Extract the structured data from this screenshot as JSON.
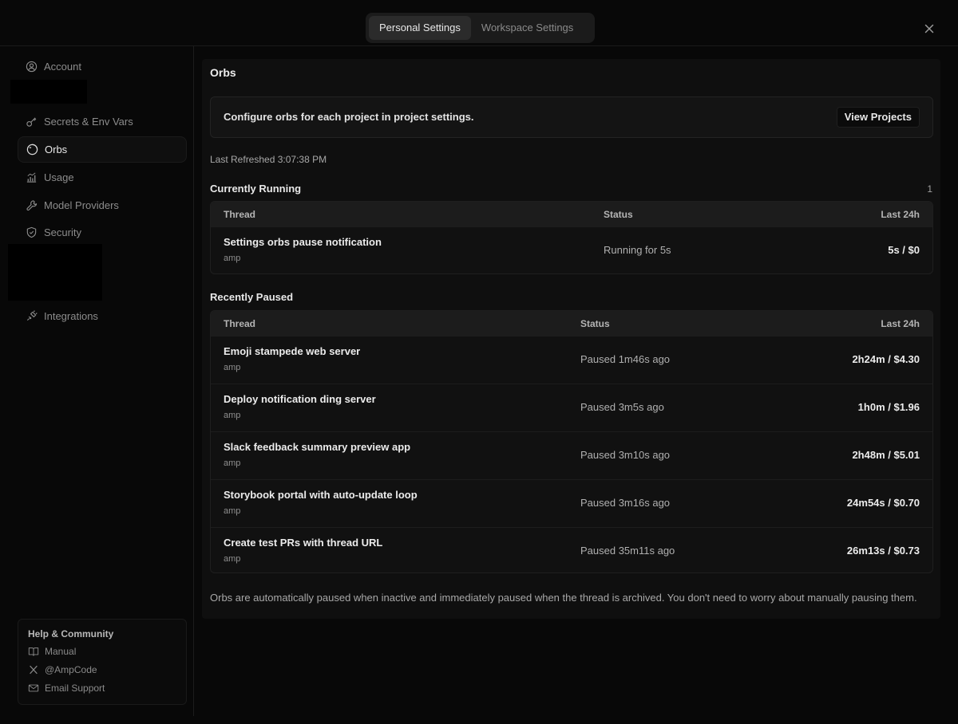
{
  "tabs": {
    "personal": "Personal Settings",
    "workspace": "Workspace Settings"
  },
  "sidebar": {
    "items": [
      {
        "label": "Account",
        "icon": "user-circle-icon"
      },
      {
        "label": "Secrets & Env Vars",
        "icon": "key-icon"
      },
      {
        "label": "Orbs",
        "icon": "orb-icon"
      },
      {
        "label": "Usage",
        "icon": "chart-icon"
      },
      {
        "label": "Model Providers",
        "icon": "wrench-icon"
      },
      {
        "label": "Security",
        "icon": "shield-icon"
      },
      {
        "label": "Integrations",
        "icon": "plug-icon"
      }
    ],
    "help": {
      "title": "Help & Community",
      "links": [
        {
          "label": "Manual",
          "icon": "book-icon"
        },
        {
          "label": "@AmpCode",
          "icon": "x-logo-icon"
        },
        {
          "label": "Email Support",
          "icon": "mail-icon"
        }
      ]
    }
  },
  "main": {
    "title": "Orbs",
    "info": {
      "text": "Configure orbs for each project in project settings.",
      "button": "View Projects"
    },
    "last_refreshed": "Last Refreshed 3:07:38 PM",
    "running": {
      "title": "Currently Running",
      "count": "1",
      "headers": {
        "thread": "Thread",
        "status": "Status",
        "last24": "Last 24h"
      },
      "rows": [
        {
          "name": "Settings orbs pause notification",
          "project": "amp",
          "status": "Running for 5s",
          "cost": "5s / $0"
        }
      ]
    },
    "paused": {
      "title": "Recently Paused",
      "headers": {
        "thread": "Thread",
        "status": "Status",
        "last24": "Last 24h"
      },
      "rows": [
        {
          "name": "Emoji stampede web server",
          "project": "amp",
          "status": "Paused 1m46s ago",
          "cost": "2h24m / $4.30"
        },
        {
          "name": "Deploy notification ding server",
          "project": "amp",
          "status": "Paused 3m5s ago",
          "cost": "1h0m / $1.96"
        },
        {
          "name": "Slack feedback summary preview app",
          "project": "amp",
          "status": "Paused 3m10s ago",
          "cost": "2h48m / $5.01"
        },
        {
          "name": "Storybook portal with auto-update loop",
          "project": "amp",
          "status": "Paused 3m16s ago",
          "cost": "24m54s / $0.70"
        },
        {
          "name": "Create test PRs with thread URL",
          "project": "amp",
          "status": "Paused 35m11s ago",
          "cost": "26m13s / $0.73"
        }
      ]
    },
    "footnote": "Orbs are automatically paused when inactive and immediately paused when the thread is archived. You don't need to worry about manually pausing them."
  }
}
